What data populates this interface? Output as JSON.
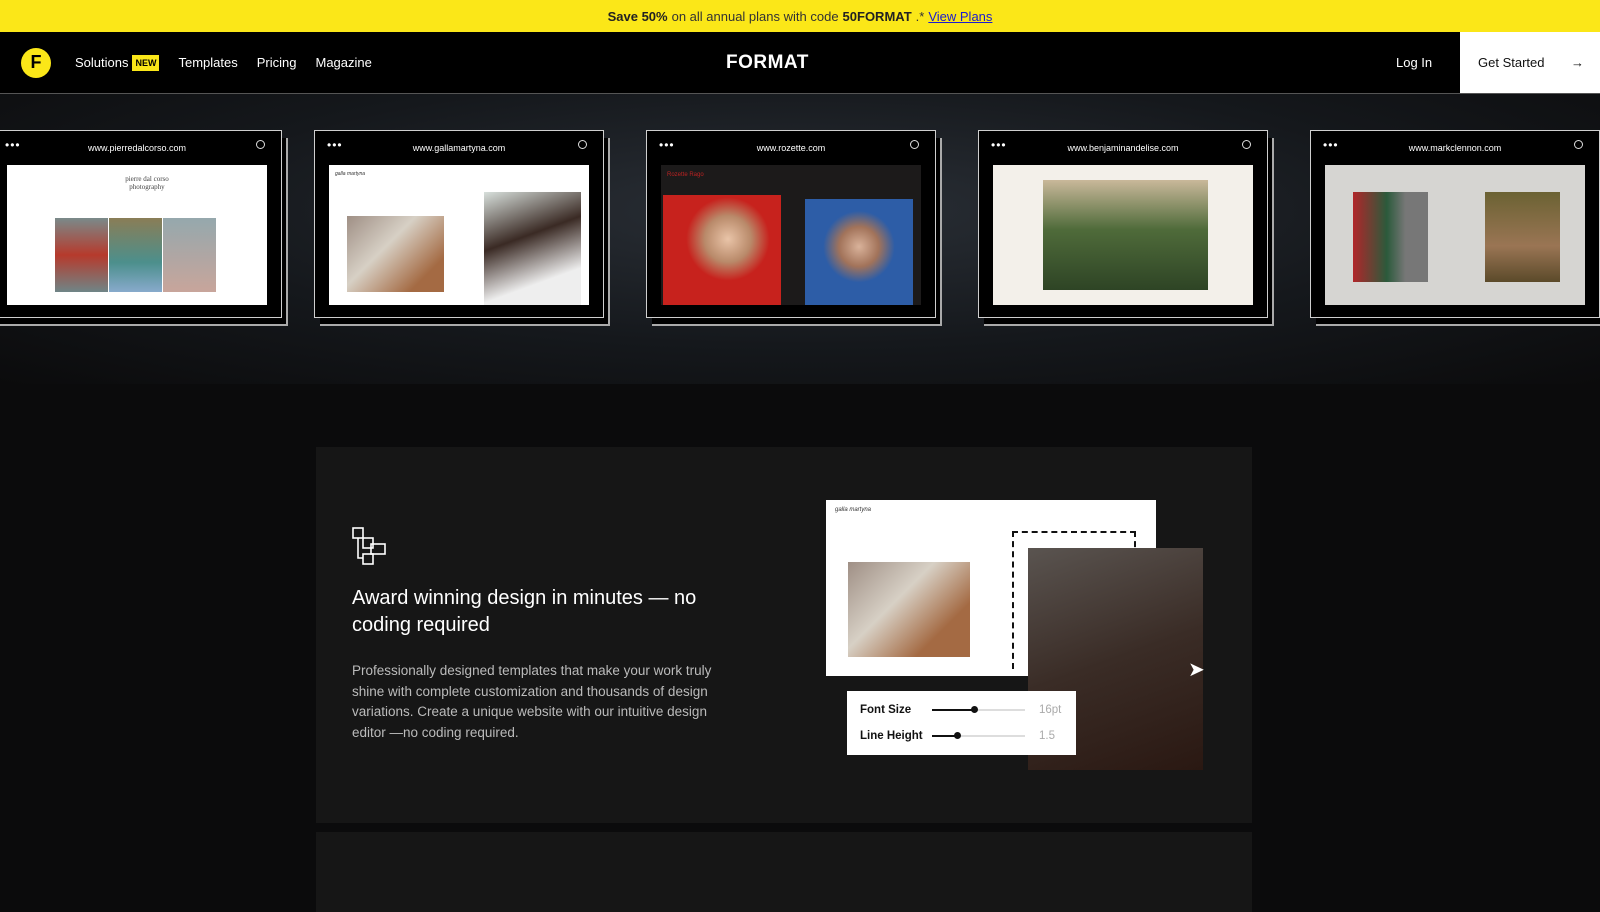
{
  "promo": {
    "bold1": "Save 50%",
    "text1": "on all annual plans with code",
    "code": "50FORMAT",
    "text2": ".*",
    "link": "View Plans"
  },
  "nav": {
    "logo": "F",
    "items": [
      {
        "label": "Solutions",
        "badge": "NEW"
      },
      {
        "label": "Templates"
      },
      {
        "label": "Pricing"
      },
      {
        "label": "Magazine"
      }
    ],
    "brand": "FORMAT",
    "login": "Log In",
    "cta": "Get Started"
  },
  "showcase": [
    {
      "url": "www.pierredalcorso.com",
      "site_title": "pierre dal corso photography"
    },
    {
      "url": "www.gallamartyna.com",
      "site_title": "galla martyna"
    },
    {
      "url": "www.rozette.com",
      "site_title": "Rozette Rago"
    },
    {
      "url": "www.benjaminandelise.com"
    },
    {
      "url": "www.markclennon.com"
    }
  ],
  "feature": {
    "icon": "layout-blocks-icon",
    "title": "Award winning design in minutes — no coding required",
    "body": "Professionally designed templates that make your work truly shine with complete customization and thousands of design variations. Create a unique website with our intuitive design editor —no coding required.",
    "mock": {
      "site_title": "galla martyna",
      "controls": [
        {
          "label": "Font Size",
          "value": "16pt",
          "level": 0.45
        },
        {
          "label": "Line Height",
          "value": "1.5",
          "level": 0.27
        }
      ]
    }
  },
  "colors": {
    "accent": "#fbe718",
    "background": "#0b0b0c"
  }
}
